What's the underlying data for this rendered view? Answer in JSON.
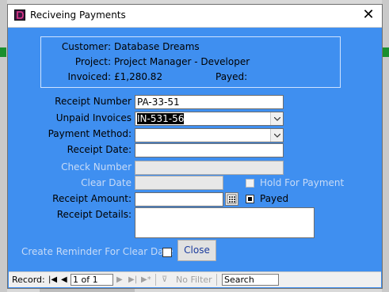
{
  "window": {
    "title": "Reciveing Payments",
    "close_glyph": "✕"
  },
  "info": {
    "customer_label": "Customer:",
    "customer_value": "Database Dreams",
    "project_label": "Project:",
    "project_value": "Project Manager - Developer",
    "invoiced_label": "Invoiced:",
    "invoiced_value": "£1,280.82",
    "payed_label": "Payed:",
    "payed_value": ""
  },
  "form": {
    "receipt_number_label": "Receipt Number",
    "receipt_number_value": "PA-33-51",
    "unpaid_invoices_label": "Unpaid Invoices",
    "unpaid_invoices_value": "IN-531-56",
    "payment_method_label": "Payment Method:",
    "payment_method_value": "",
    "receipt_date_label": "Receipt Date:",
    "receipt_date_value": "",
    "check_number_label": "Check Number",
    "check_number_value": "",
    "clear_date_label": "Clear Date",
    "clear_date_value": "",
    "hold_for_payment_label": "Hold For Payment",
    "receipt_amount_label": "Receipt Amount:",
    "receipt_amount_value": "",
    "payed_label": "Payed",
    "receipt_details_label": "Receipt Details:",
    "receipt_details_value": "",
    "reminder_label": "Create Reminder For Clear Date",
    "close_button_label": "Close"
  },
  "navigation": {
    "record_label": "Record:",
    "record_position": "1 of 1",
    "no_filter_label": "No Filter",
    "search_placeholder": "Search"
  },
  "colors": {
    "form_background": "#3f8ff0",
    "disabled_text": "#c7dbf7"
  }
}
